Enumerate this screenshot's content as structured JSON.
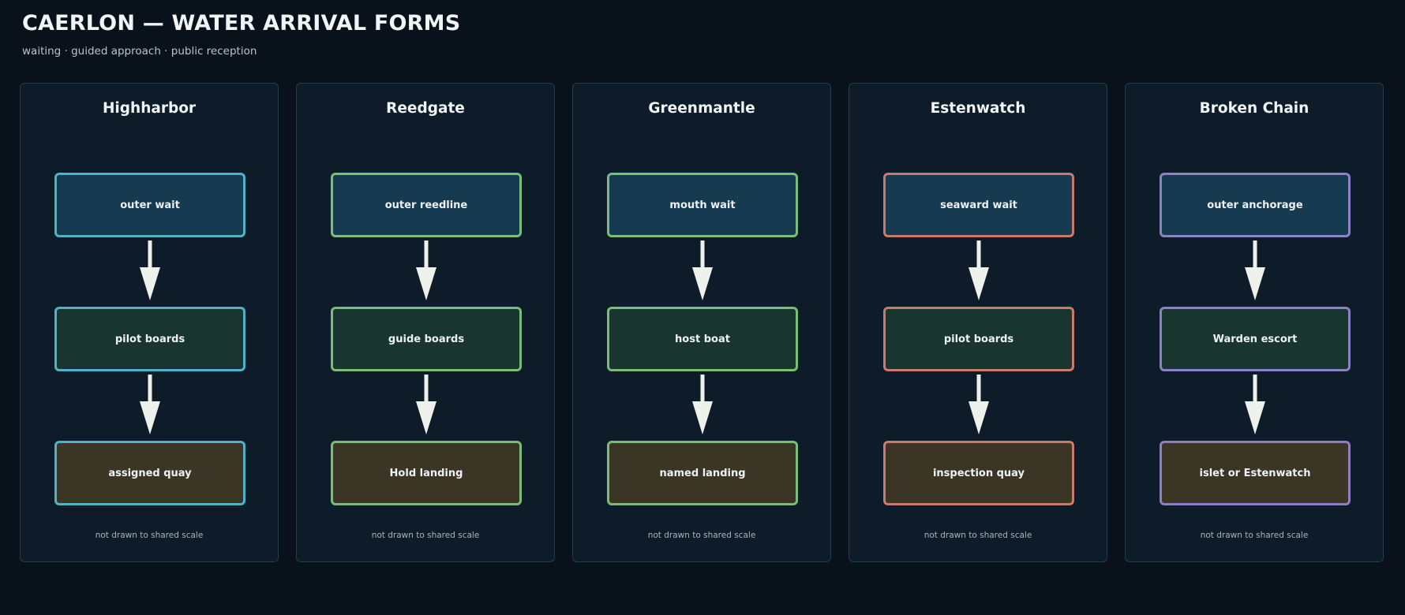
{
  "header": {
    "title": "CAERLON — WATER ARRIVAL FORMS",
    "subtitle": "waiting · guided approach · public reception"
  },
  "columns": [
    {
      "name": "Highharbor",
      "color": "#4fb3c8",
      "steps": [
        "outer wait",
        "pilot boards",
        "assigned quay"
      ],
      "note": "not drawn to shared scale"
    },
    {
      "name": "Reedgate",
      "color": "#78bd78",
      "steps": [
        "outer reedline",
        "guide boards",
        "Hold landing"
      ],
      "note": "not drawn to shared scale"
    },
    {
      "name": "Greenmantle",
      "color": "#78bd78",
      "steps": [
        "mouth wait",
        "host boat",
        "named landing"
      ],
      "note": "not drawn to shared scale"
    },
    {
      "name": "Estenwatch",
      "color": "#c97a6c",
      "steps": [
        "seaward wait",
        "pilot boards",
        "inspection quay"
      ],
      "note": "not drawn to shared scale"
    },
    {
      "name": "Broken Chain",
      "color": "#8d80c4",
      "steps": [
        "outer anchorage",
        "Warden escort",
        "islet or Estenwatch"
      ],
      "note": "not drawn to shared scale"
    }
  ]
}
